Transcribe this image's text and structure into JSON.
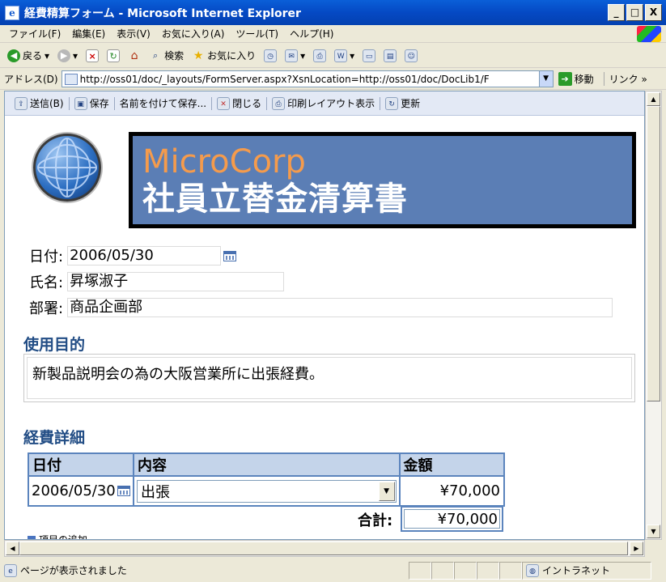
{
  "window": {
    "title": "経費精算フォーム - Microsoft Internet Explorer",
    "app_icon": "e",
    "controls": [
      "_",
      "□",
      "X"
    ]
  },
  "menu": [
    "ファイル(F)",
    "編集(E)",
    "表示(V)",
    "お気に入り(A)",
    "ツール(T)",
    "ヘルプ(H)"
  ],
  "toolbar": {
    "back": "戻る",
    "search": "検索",
    "favorites": "お気に入り"
  },
  "address": {
    "label": "アドレス(D)",
    "url": "http://oss01/doc/_layouts/FormServer.aspx?XsnLocation=http://oss01/doc/DocLib1/F",
    "go": "移動",
    "links": "リンク"
  },
  "form_toolbar": {
    "send": "送信(B)",
    "save": "保存",
    "save_as": "名前を付けて保存...",
    "close": "閉じる",
    "print_layout": "印刷レイアウト表示",
    "update": "更新"
  },
  "banner": {
    "brand": "MicroCorp",
    "title": "社員立替金清算書"
  },
  "fields": {
    "date_label": "日付:",
    "date_value": "2006/05/30",
    "name_label": "氏名:",
    "name_value": "昇塚淑子",
    "dept_label": "部署:",
    "dept_value": "商品企画部"
  },
  "purpose": {
    "heading": "使用目的",
    "text": "新製品説明会の為の大阪営業所に出張経費。"
  },
  "details": {
    "heading": "経費詳細",
    "columns": [
      "日付",
      "内容",
      "金額"
    ],
    "rows": [
      {
        "date": "2006/05/30",
        "content": "出張",
        "amount": "¥70,000"
      }
    ],
    "total_label": "合計:",
    "total_value": "¥70,000",
    "add_item": "項目の追加"
  },
  "status": {
    "text": "ページが表示されました",
    "zone": "イントラネット"
  },
  "colors": {
    "banner_bg": "#5b7eb5",
    "brand_orange": "#f59b4c",
    "section_heading": "#224d85",
    "table_border": "#5b84bd"
  }
}
